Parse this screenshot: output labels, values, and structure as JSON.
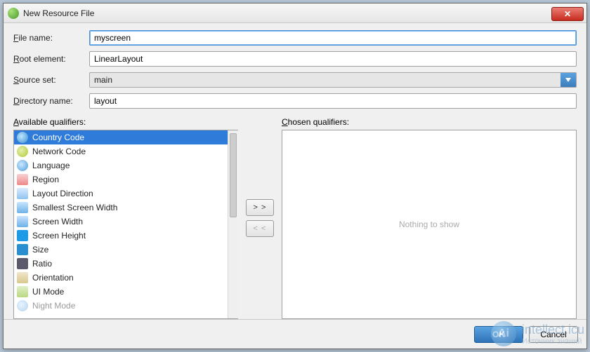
{
  "window": {
    "title": "New Resource File",
    "close_glyph": "✕"
  },
  "form": {
    "file_name_label_pre": "F",
    "file_name_label_post": "ile name:",
    "file_name_value": "myscreen",
    "root_element_label_pre": "R",
    "root_element_label_post": "oot element:",
    "root_element_value": "LinearLayout",
    "source_set_label_pre": "S",
    "source_set_label_post": "ource set:",
    "source_set_value": "main",
    "directory_label_pre": "D",
    "directory_label_post": "irectory name:",
    "directory_value": "layout"
  },
  "qualifiers": {
    "available_label_pre": "A",
    "available_label_post": "vailable qualifiers:",
    "chosen_label_pre": "C",
    "chosen_label_post": "hosen qualifiers:",
    "nothing_text": "Nothing to show",
    "add_label": "> >",
    "remove_label": "< <",
    "items": [
      {
        "label": "Country Code"
      },
      {
        "label": "Network Code"
      },
      {
        "label": "Language"
      },
      {
        "label": "Region"
      },
      {
        "label": "Layout Direction"
      },
      {
        "label": "Smallest Screen Width"
      },
      {
        "label": "Screen Width"
      },
      {
        "label": "Screen Height"
      },
      {
        "label": "Size"
      },
      {
        "label": "Ratio"
      },
      {
        "label": "Orientation"
      },
      {
        "label": "UI Mode"
      },
      {
        "label": "Night Mode"
      }
    ]
  },
  "footer": {
    "ok_label": "OK",
    "cancel_label": "Cancel"
  },
  "watermark": {
    "icon_text": "Ai",
    "line1": "intellect.icu",
    "line2": "Источник знаний"
  }
}
